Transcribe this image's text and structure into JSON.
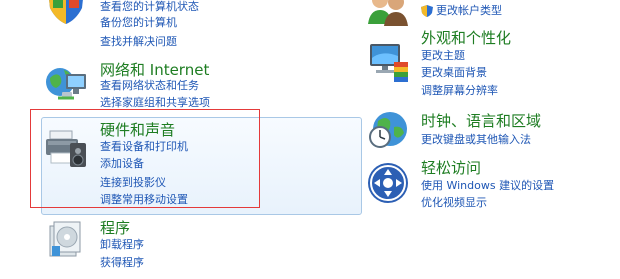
{
  "left": {
    "system": {
      "links": [
        "查看您的计算机状态",
        "备份您的计算机",
        "查找并解决问题"
      ]
    },
    "network": {
      "title": "网络和 Internet",
      "links": [
        "查看网络状态和任务",
        "选择家庭组和共享选项"
      ]
    },
    "hardware": {
      "title": "硬件和声音",
      "links": [
        "查看设备和打印机",
        "添加设备",
        "连接到投影仪",
        "调整常用移动设置"
      ]
    },
    "programs": {
      "title": "程序",
      "links": [
        "卸载程序",
        "获得程序"
      ]
    }
  },
  "right": {
    "accounts": {
      "links": [
        "更改帐户类型"
      ]
    },
    "appearance": {
      "title": "外观和个性化",
      "links": [
        "更改主题",
        "更改桌面背景",
        "调整屏幕分辨率"
      ]
    },
    "clock": {
      "title": "时钟、语言和区域",
      "links": [
        "更改键盘或其他输入法"
      ]
    },
    "access": {
      "title": "轻松访问",
      "links": [
        "使用 Windows 建议的设置",
        "优化视频显示"
      ]
    }
  },
  "colors": {
    "title_green": "#1e7d22",
    "link_blue": "#1f57b5",
    "annotation_red": "#e43a3a",
    "hover_border": "#a9c8e6"
  }
}
